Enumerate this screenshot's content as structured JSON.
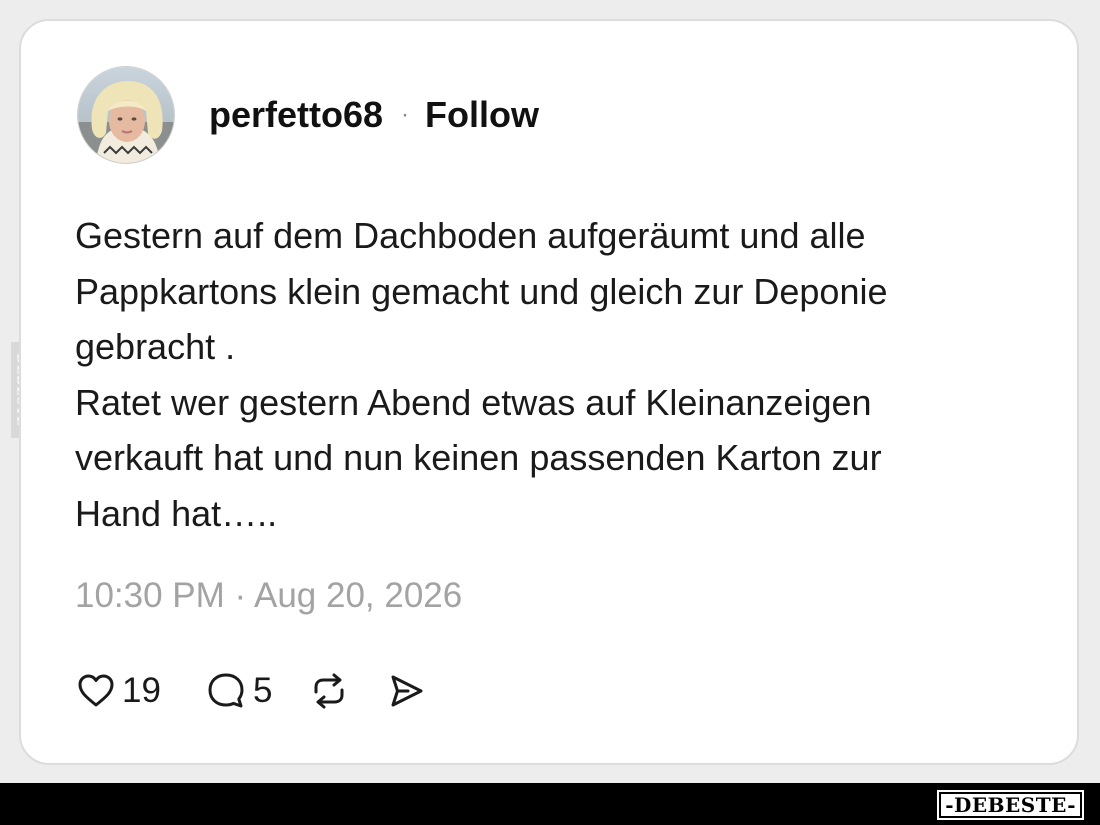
{
  "post": {
    "username": "perfetto68",
    "separator": "·",
    "follow_label": "Follow",
    "text_lines": [
      "Gestern auf dem Dachboden aufgeräumt und alle",
      "Pappkartons klein gemacht und gleich zur Deponie",
      "gebracht .",
      "Ratet wer gestern Abend etwas auf Kleinanzeigen",
      "verkauft hat und nun keinen passenden Karton zur",
      "Hand hat….."
    ],
    "timestamp": "10:30 PM · Aug 20, 2026",
    "likes": "19",
    "replies": "5"
  },
  "icons": {
    "like": "heart-icon",
    "reply": "comment-bubble-icon",
    "repost": "repost-arrows-icon",
    "share": "send-icon"
  },
  "watermark": {
    "side_text": "DEBESTE",
    "footer_text": "-DEBESTE-"
  },
  "colors": {
    "background": "#ededed",
    "card": "#ffffff",
    "text": "#1a1a1a",
    "muted": "#a3a3a3",
    "footer": "#000000"
  }
}
